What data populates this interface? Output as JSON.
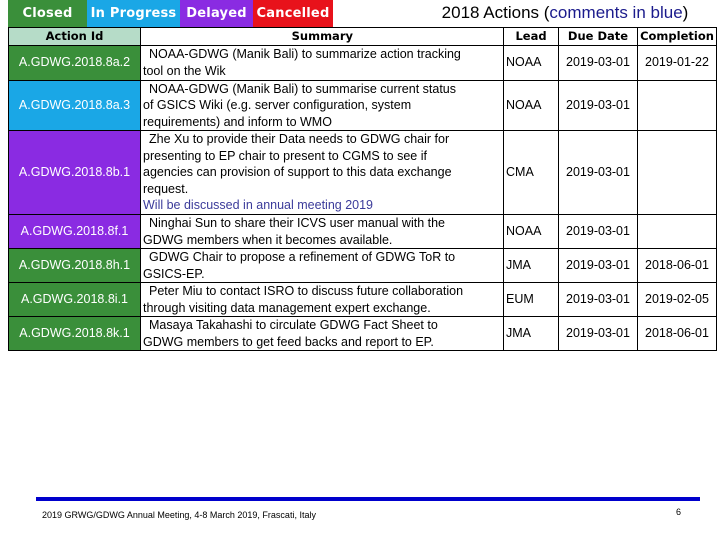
{
  "legend": [
    {
      "label": "Closed",
      "color": "#3a8f3a"
    },
    {
      "label": "In Progress",
      "color": "#1aa7e6"
    },
    {
      "label": "Delayed",
      "color": "#8a2be2"
    },
    {
      "label": "Cancelled",
      "color": "#e8121b"
    }
  ],
  "title": {
    "main": "2018 Actions (",
    "highlight": "comments in blue",
    "end": ")",
    "highlight_color": "#1b1b8c"
  },
  "table": {
    "headers": {
      "action_id": "Action Id",
      "summary": "Summary",
      "lead": "Lead",
      "due_date": "Due Date",
      "completion": "Completion"
    },
    "rows": [
      {
        "id": "A.GDWG.2018.8a.2",
        "status": "Closed",
        "status_color": "#3a8f3a",
        "summary_lines": [
          "NOAA-GDWG (Manik Bali) to summarize action tracking",
          "tool on the Wik"
        ],
        "comment": "",
        "lead": "NOAA",
        "due_date": "2019-03-01",
        "completion": "2019-01-22"
      },
      {
        "id": "A.GDWG.2018.8a.3",
        "status": "In Progress",
        "status_color": "#1aa7e6",
        "summary_lines": [
          "NOAA-GDWG (Manik Bali) to summarise current status",
          "of GSICS Wiki (e.g. server configuration, system",
          "requirements) and inform to WMO"
        ],
        "comment": "",
        "lead": "NOAA",
        "due_date": "2019-03-01",
        "completion": ""
      },
      {
        "id": "A.GDWG.2018.8b.1",
        "status": "Delayed",
        "status_color": "#8a2be2",
        "summary_lines": [
          "Zhe Xu to provide their Data needs to GDWG chair for",
          "presenting to EP chair to present to CGMS to see if",
          "agencies can provision of support to this data exchange",
          "request."
        ],
        "comment": "Will be discussed in annual meeting 2019",
        "lead": "CMA",
        "due_date": "2019-03-01",
        "completion": ""
      },
      {
        "id": "A.GDWG.2018.8f.1",
        "status": "Delayed",
        "status_color": "#8a2be2",
        "summary_lines": [
          "Ninghai Sun to share their ICVS user manual with the",
          "GDWG members when it becomes available."
        ],
        "comment": "",
        "lead": "NOAA",
        "due_date": "2019-03-01",
        "completion": ""
      },
      {
        "id": "A.GDWG.2018.8h.1",
        "status": "Closed",
        "status_color": "#3a8f3a",
        "summary_lines": [
          "GDWG Chair to propose a refinement of GDWG ToR to",
          "GSICS-EP."
        ],
        "comment": "",
        "lead": "JMA",
        "due_date": "2019-03-01",
        "completion": "2018-06-01"
      },
      {
        "id": "A.GDWG.2018.8i.1",
        "status": "Closed",
        "status_color": "#3a8f3a",
        "summary_lines": [
          "Peter Miu to contact ISRO to discuss future collaboration",
          "through visiting data management expert exchange."
        ],
        "comment": "",
        "lead": "EUM",
        "due_date": "2019-03-01",
        "completion": "2019-02-05"
      },
      {
        "id": "A.GDWG.2018.8k.1",
        "status": "Closed",
        "status_color": "#3a8f3a",
        "summary_lines": [
          "Masaya Takahashi to circulate GDWG Fact Sheet to",
          "GDWG members to get feed backs and report to EP."
        ],
        "comment": "",
        "lead": "JMA",
        "due_date": "2019-03-01",
        "completion": "2018-06-01"
      }
    ]
  },
  "footer": {
    "text": "2019 GRWG/GDWG Annual Meeting, 4-8 March 2019, Frascati, Italy",
    "page_number": "6",
    "line_color": "#0000cc"
  }
}
